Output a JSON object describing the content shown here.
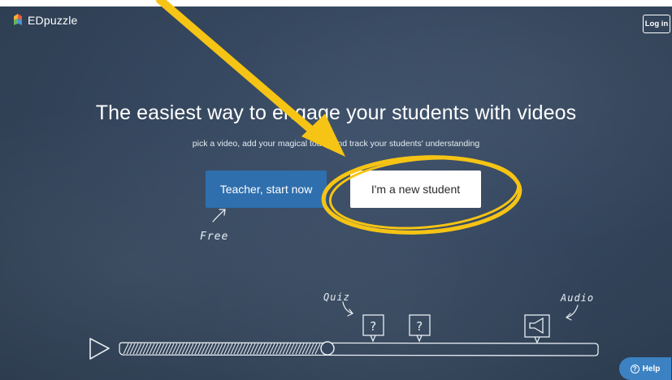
{
  "app": {
    "brand": "EDpuzzle",
    "login_label": "Log in"
  },
  "hero": {
    "headline": "The easiest way to engage your students with videos",
    "subline": "pick a video, add your magical touch and track your students' understanding"
  },
  "cta": {
    "teacher_label": "Teacher, start now",
    "student_label": "I'm a new student"
  },
  "chalk_notes": {
    "free": "Free",
    "quiz": "Quiz",
    "audio": "Audio",
    "question_mark": "?"
  },
  "help": {
    "label": "Help",
    "icon_glyph": "?"
  },
  "annotation": {
    "arrow_color": "#f6c414",
    "ellipse_color": "#f6c414"
  },
  "colors": {
    "board": "#34465d",
    "teacher_button": "#2f6fae",
    "help_button": "#3c82c3"
  }
}
